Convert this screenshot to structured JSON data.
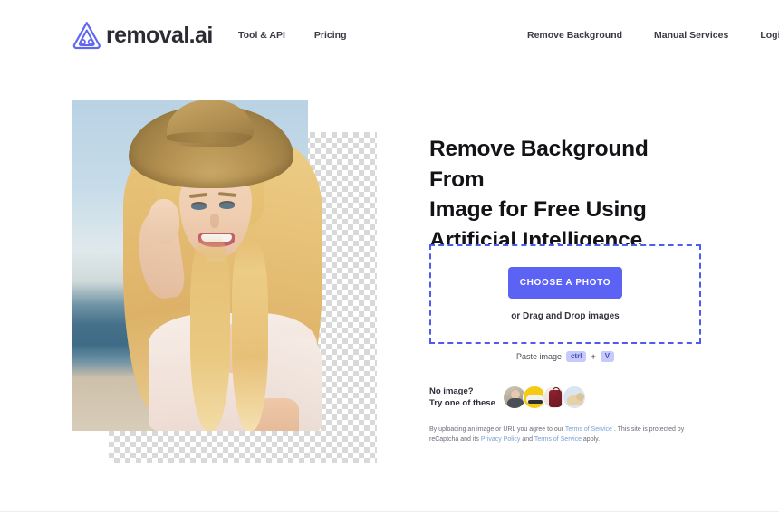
{
  "header": {
    "logo_text": "removal.ai",
    "logo_icon": "removal-ai-logo-icon",
    "nav_left": [
      {
        "label": "Tool & API"
      },
      {
        "label": "Pricing"
      }
    ],
    "nav_right": [
      {
        "label": "Remove Background"
      },
      {
        "label": "Manual Services"
      },
      {
        "label": "Login"
      }
    ]
  },
  "demo": {
    "alt": "woman in straw hat at beach with background removed",
    "transparency_pattern": "checkerboard"
  },
  "hero": {
    "headline": "Remove Background From Image for Free Using Artificial Intelligence",
    "headline_lines": [
      "Remove Background From",
      "Image for Free Using",
      "Artificial Intelligence"
    ]
  },
  "upload": {
    "button_label": "CHOOSE A PHOTO",
    "drag_text": "or Drag and Drop images",
    "paste_label": "Paste image",
    "key_ctrl": "ctrl",
    "key_plus": "+",
    "key_v": "V"
  },
  "samples": {
    "label_line1": "No image?",
    "label_line2": "Try one of these",
    "thumbs": [
      {
        "name": "sample-person"
      },
      {
        "name": "sample-car"
      },
      {
        "name": "sample-suitcase"
      },
      {
        "name": "sample-dog"
      }
    ]
  },
  "legal": {
    "part1": "By uploading an image or URL you agree to our ",
    "link1": "Terms of Service",
    "part2": " . This site is protected by reCaptcha and its ",
    "link2": "Privacy Policy",
    "part3": " and ",
    "link3": "Terms of Service",
    "part4": " apply."
  },
  "colors": {
    "brand_purple": "#5b62f4",
    "dropzone_border": "#4f5bf0",
    "kbd_bg": "#c6c9fb",
    "link": "#7a9fd4"
  }
}
